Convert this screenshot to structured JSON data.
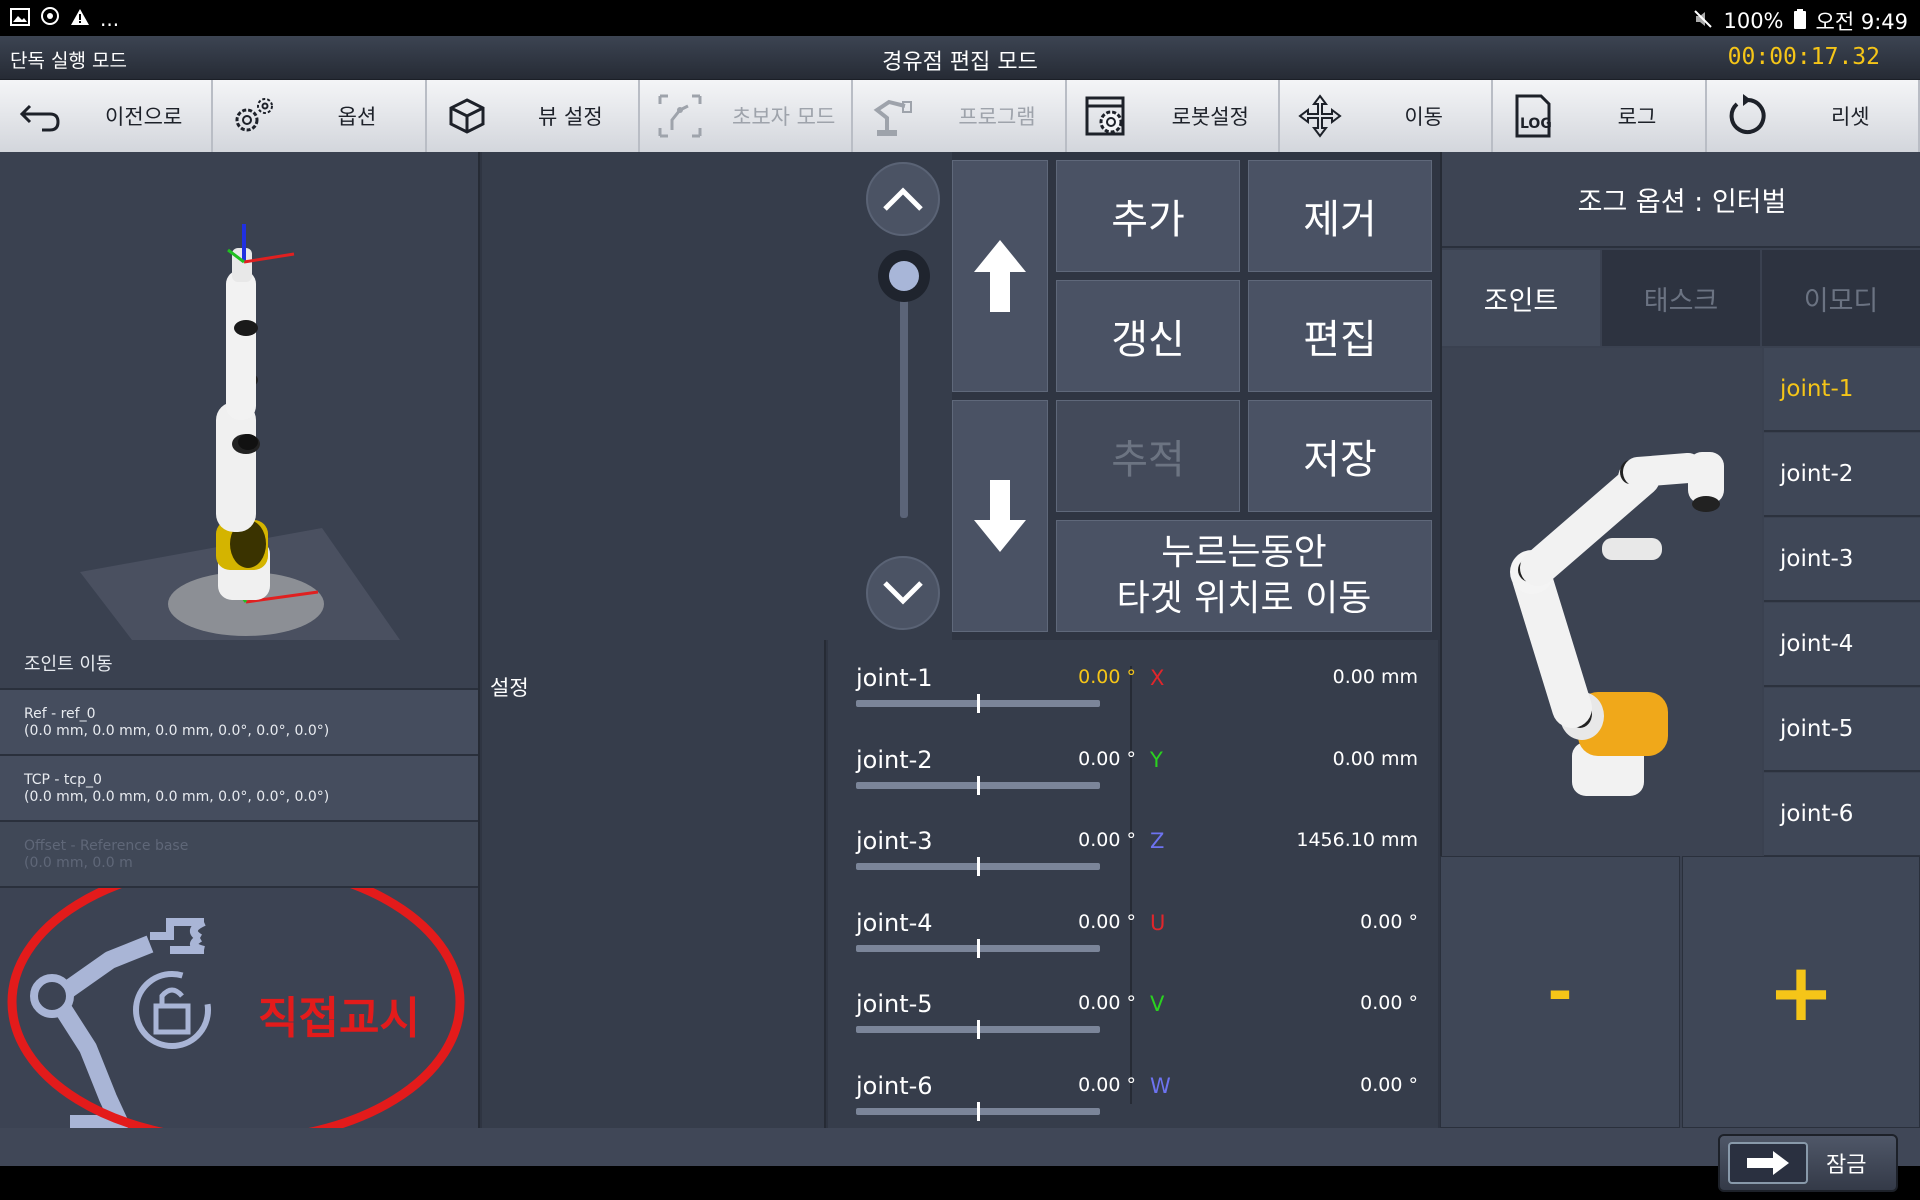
{
  "status": {
    "battery": "100%",
    "ampm_time": "오전 9:49",
    "ellipsis": "..."
  },
  "modebar": {
    "left_label": "단독 실행 모드",
    "title": "경유점 편집 모드",
    "timer": "00:00:17.32"
  },
  "toolbar": {
    "back": "이전으로",
    "options": "옵션",
    "view": "뷰 설정",
    "beginner": "초보자 모드",
    "program": "프로그램",
    "robot": "로봇설정",
    "move": "이동",
    "log": "로그",
    "reset": "리셋",
    "log_icon_text": "LOG"
  },
  "editor": {
    "add": "추가",
    "remove": "제거",
    "update": "갱신",
    "edit": "편집",
    "trace": "추적",
    "save": "저장",
    "hold_line1": "누르는동안",
    "hold_line2": "타겟 위치로 이동"
  },
  "left_info": {
    "joint_move": "조인트 이동",
    "ref_name": "Ref - ref_0",
    "ref_vals": "(0.0 mm, 0.0 mm, 0.0 mm, 0.0°, 0.0°, 0.0°)",
    "tcp_name": "TCP - tcp_0",
    "tcp_vals": "(0.0 mm, 0.0 mm, 0.0 mm, 0.0°, 0.0°, 0.0°)",
    "offset_name": "Offset - Reference base",
    "offset_vals": "(0.0 mm, 0.0 m",
    "direct_teach": "직접교시"
  },
  "setting_label": "설정",
  "joints": [
    {
      "name": "joint-1",
      "value": "0.00 °",
      "highlight": true,
      "level": 0.5
    },
    {
      "name": "joint-2",
      "value": "0.00 °",
      "highlight": false,
      "level": 0.5
    },
    {
      "name": "joint-3",
      "value": "0.00 °",
      "highlight": false,
      "level": 0.5
    },
    {
      "name": "joint-4",
      "value": "0.00 °",
      "highlight": false,
      "level": 0.5
    },
    {
      "name": "joint-5",
      "value": "0.00 °",
      "highlight": false,
      "level": 0.5
    },
    {
      "name": "joint-6",
      "value": "0.00 °",
      "highlight": false,
      "level": 0.5
    }
  ],
  "coords": [
    {
      "axis": "X",
      "value": "0.00 mm",
      "color": "#e0262b"
    },
    {
      "axis": "Y",
      "value": "0.00 mm",
      "color": "#2ad21f"
    },
    {
      "axis": "Z",
      "value": "1456.10 mm",
      "color": "#6d73f0"
    },
    {
      "axis": "U",
      "value": "0.00 °",
      "color": "#e0262b"
    },
    {
      "axis": "V",
      "value": "0.00 °",
      "color": "#2ad21f"
    },
    {
      "axis": "W",
      "value": "0.00 °",
      "color": "#6d73f0"
    }
  ],
  "jog": {
    "title": "조그 옵션 : 인터벌",
    "tabs": [
      "조인트",
      "태스크",
      "이모디"
    ],
    "joint_list": [
      "joint-1",
      "joint-2",
      "joint-3",
      "joint-4",
      "joint-5",
      "joint-6"
    ],
    "minus": "-",
    "plus": "+"
  },
  "lock": "잠금",
  "colors": {
    "accent_yellow": "#f5c518",
    "annotation_red": "#e31b1b"
  }
}
